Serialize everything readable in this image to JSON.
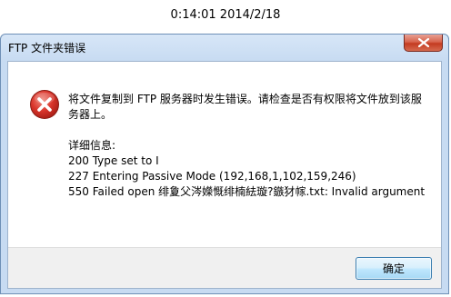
{
  "timestamp": "0:14:01 2014/2/18",
  "dialog": {
    "title": "FTP 文件夹错误",
    "message": "将文件复制到 FTP 服务器时发生错误。请检查是否有权限将文件放到该服务器上。",
    "details_label": "详细信息:",
    "details_lines": [
      "200 Type set to I",
      "227 Entering Passive Mode (192,168,1,102,159,246)",
      "550 Failed open 绯夐父涔嬫慨绯楠紶璇?鏃犲幏.txt: Invalid argument"
    ],
    "ok_label": "确定"
  },
  "icons": {
    "error": "error-icon",
    "close": "close-icon"
  },
  "colors": {
    "error_red": "#d9352b",
    "close_red": "#c43a20",
    "button_border": "#3c7fb1"
  }
}
